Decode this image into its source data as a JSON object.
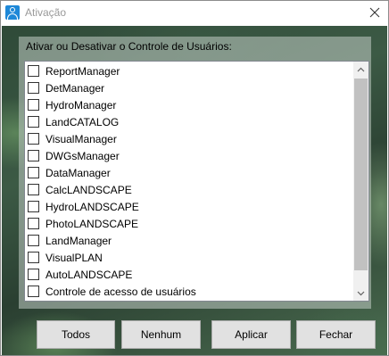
{
  "window": {
    "title": "Ativação"
  },
  "group": {
    "label": "Ativar ou Desativar o Controle de Usuários:"
  },
  "items": [
    {
      "label": "ReportManager",
      "checked": false
    },
    {
      "label": "DetManager",
      "checked": false
    },
    {
      "label": "HydroManager",
      "checked": false
    },
    {
      "label": "LandCATALOG",
      "checked": false
    },
    {
      "label": "VisualManager",
      "checked": false
    },
    {
      "label": "DWGsManager",
      "checked": false
    },
    {
      "label": "DataManager",
      "checked": false
    },
    {
      "label": "CalcLANDSCAPE",
      "checked": false
    },
    {
      "label": "HydroLANDSCAPE",
      "checked": false
    },
    {
      "label": "PhotoLANDSCAPE",
      "checked": false
    },
    {
      "label": "LandManager",
      "checked": false
    },
    {
      "label": "VisualPLAN",
      "checked": false
    },
    {
      "label": "AutoLANDSCAPE",
      "checked": false
    },
    {
      "label": "Controle de acesso de usuários",
      "checked": false
    }
  ],
  "buttons": {
    "all": "Todos",
    "none": "Nenhum",
    "apply": "Aplicar",
    "close": "Fechar"
  },
  "colors": {
    "accent": "#1e88d8",
    "button_bg": "#e1e1e1"
  }
}
